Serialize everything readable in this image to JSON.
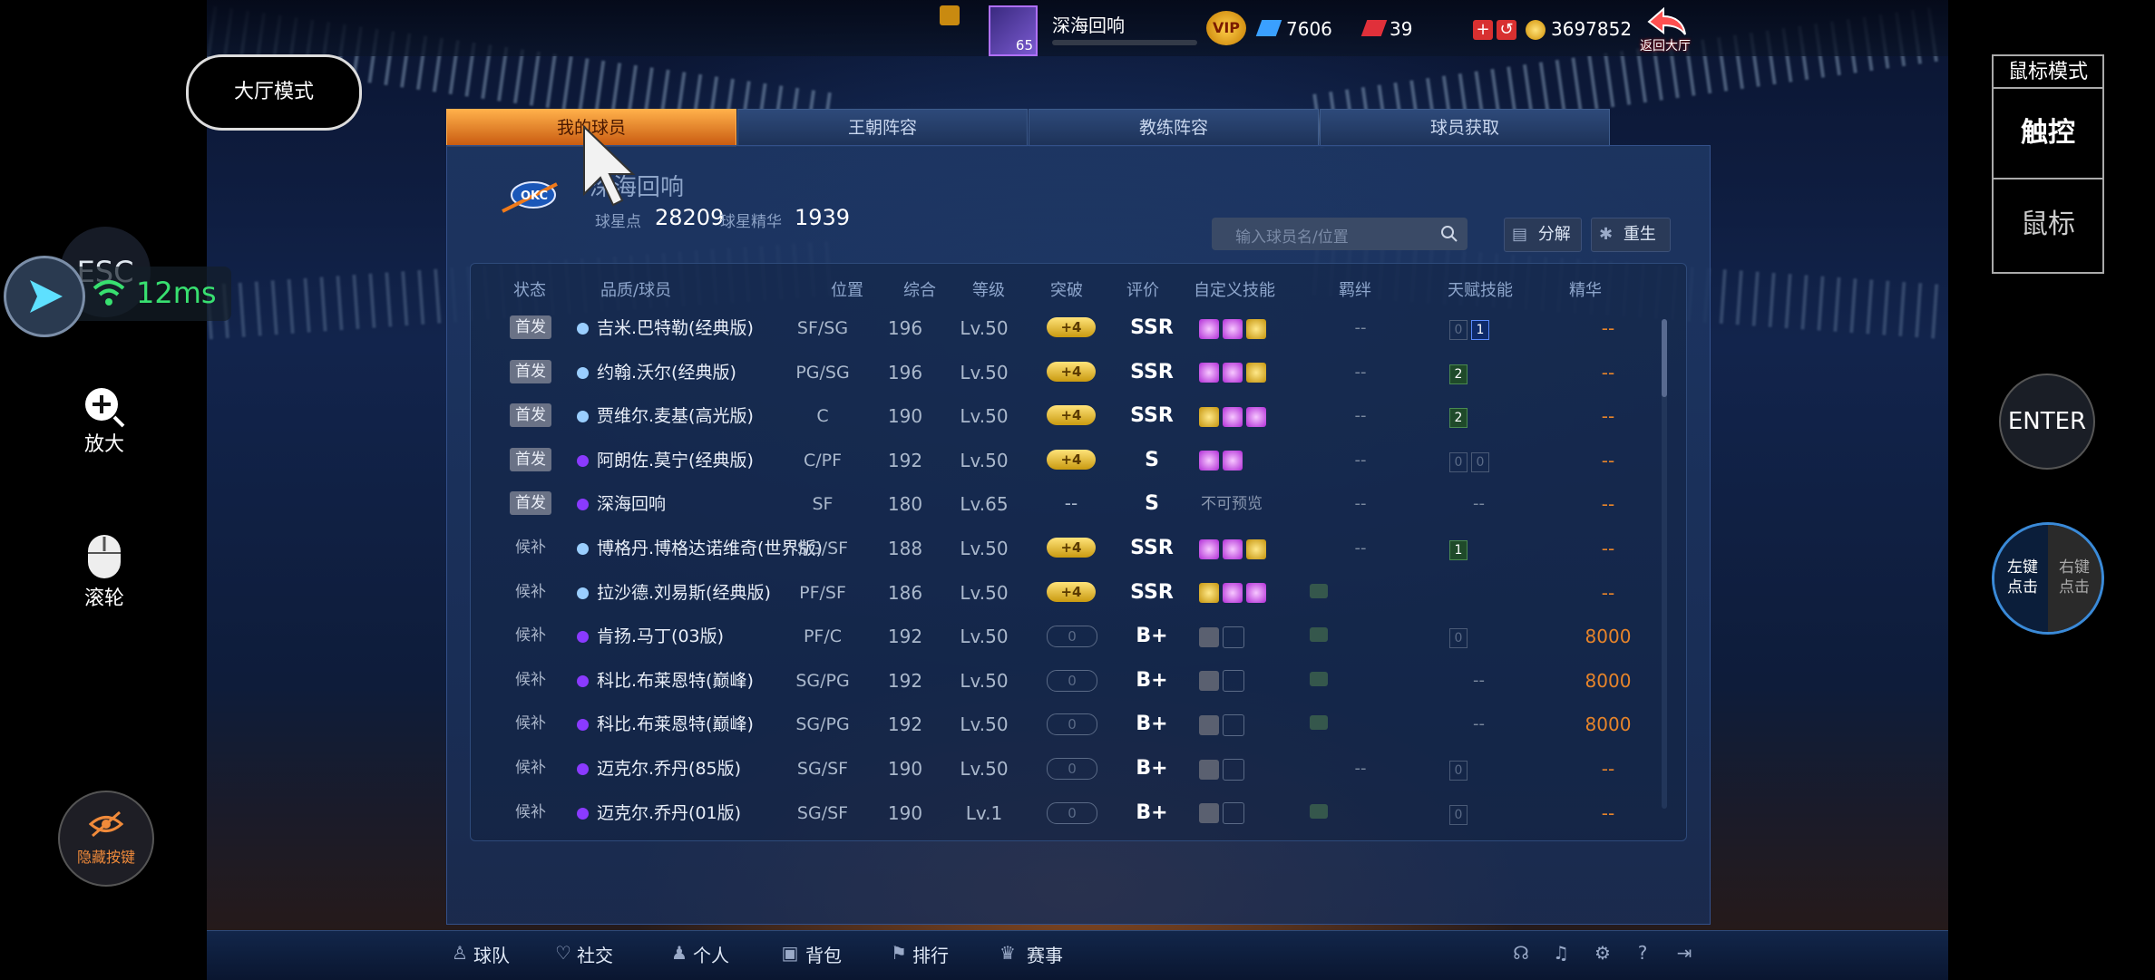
{
  "topbar": {
    "avatar_level": "65",
    "player_name": "深海回响",
    "vip_label": "VIP",
    "diamonds": "7606",
    "tickets": "39",
    "coins": "3697852",
    "back_label": "返回大厅"
  },
  "overlay_left": {
    "hall_mode": "大厅模式",
    "esc": "ESC",
    "latency": "12ms",
    "zoom_label": "放大",
    "wheel_label": "滚轮",
    "hide_keys": "隐藏按键"
  },
  "overlay_right": {
    "mode_title": "鼠标模式",
    "touch": "触控",
    "mouse": "鼠标",
    "enter": "ENTER",
    "left_click": "左键点击",
    "right_click": "右键点击"
  },
  "tabs": [
    "我的球员",
    "王朝阵容",
    "教练阵容",
    "球员获取"
  ],
  "team": {
    "name": "深海回响",
    "star_points_label": "球星点",
    "star_points": "28209",
    "essence_label": "球星精华",
    "essence": "1939"
  },
  "search": {
    "placeholder": "输入球员名/位置"
  },
  "actions": {
    "decompose": "分解",
    "rebirth": "重生"
  },
  "columns": [
    "状态",
    "品质/球员",
    "位置",
    "综合",
    "等级",
    "突破",
    "评价",
    "自定义技能",
    "羁绊",
    "天赋技能",
    "精华"
  ],
  "rows": [
    {
      "status": "首发",
      "name": "吉米.巴特勒(经典版)",
      "pos": "SF/SG",
      "ovr": "196",
      "lvl": "Lv.50",
      "brk": "+4",
      "grade": "SSR",
      "bond": "--",
      "ess": "--"
    },
    {
      "status": "首发",
      "name": "约翰.沃尔(经典版)",
      "pos": "PG/SG",
      "ovr": "196",
      "lvl": "Lv.50",
      "brk": "+4",
      "grade": "SSR",
      "bond": "--",
      "ess": "--"
    },
    {
      "status": "首发",
      "name": "贾维尔.麦基(高光版)",
      "pos": "C",
      "ovr": "190",
      "lvl": "Lv.50",
      "brk": "+4",
      "grade": "SSR",
      "bond": "--",
      "ess": "--"
    },
    {
      "status": "首发",
      "name": "阿朗佐.莫宁(经典版)",
      "pos": "C/PF",
      "ovr": "192",
      "lvl": "Lv.50",
      "brk": "+4",
      "grade": "S",
      "bond": "--",
      "ess": "--"
    },
    {
      "status": "首发",
      "name": "深海回响",
      "pos": "SF",
      "ovr": "180",
      "lvl": "Lv.65",
      "brk": "--",
      "grade": "S",
      "skilltxt": "不可预览",
      "bond": "--",
      "talenttxt": "--",
      "ess": "--"
    },
    {
      "status": "候补",
      "name": "博格丹.博格达诺维奇(世界版)",
      "pos": "SG/SF",
      "ovr": "188",
      "lvl": "Lv.50",
      "brk": "+4",
      "grade": "SSR",
      "bond": "--",
      "ess": "--"
    },
    {
      "status": "候补",
      "name": "拉沙德.刘易斯(经典版)",
      "pos": "PF/SF",
      "ovr": "186",
      "lvl": "Lv.50",
      "brk": "+4",
      "grade": "SSR",
      "bond": "",
      "ess": "--"
    },
    {
      "status": "候补",
      "name": "肯扬.马丁(03版)",
      "pos": "PF/C",
      "ovr": "192",
      "lvl": "Lv.50",
      "brk": "0",
      "grade": "B+",
      "bond": "",
      "ess": "8000"
    },
    {
      "status": "候补",
      "name": "科比.布莱恩特(巅峰)",
      "pos": "SG/PG",
      "ovr": "192",
      "lvl": "Lv.50",
      "brk": "0",
      "grade": "B+",
      "bond": "",
      "talenttxt": "--",
      "ess": "8000"
    },
    {
      "status": "候补",
      "name": "科比.布莱恩特(巅峰)",
      "pos": "SG/PG",
      "ovr": "192",
      "lvl": "Lv.50",
      "brk": "0",
      "grade": "B+",
      "bond": "",
      "talenttxt": "--",
      "ess": "8000"
    },
    {
      "status": "候补",
      "name": "迈克尔.乔丹(85版)",
      "pos": "SG/SF",
      "ovr": "190",
      "lvl": "Lv.50",
      "brk": "0",
      "grade": "B+",
      "bond": "--",
      "ess": "--"
    },
    {
      "status": "候补",
      "name": "迈克尔.乔丹(01版)",
      "pos": "SG/SF",
      "ovr": "190",
      "lvl": "Lv.1",
      "brk": "0",
      "grade": "B+",
      "bond": "",
      "ess": "--"
    }
  ],
  "talents": {
    "r0": [
      "0",
      "1"
    ],
    "r1": [
      "2"
    ],
    "r2": [
      "2"
    ],
    "r3": [
      "0",
      "0"
    ],
    "r5": [
      "1"
    ],
    "r7": [
      "0"
    ],
    "r10": [
      "0"
    ],
    "r11": [
      "0"
    ]
  },
  "bottom_nav": [
    "球队",
    "社交",
    "个人",
    "背包",
    "排行",
    "赛事"
  ]
}
